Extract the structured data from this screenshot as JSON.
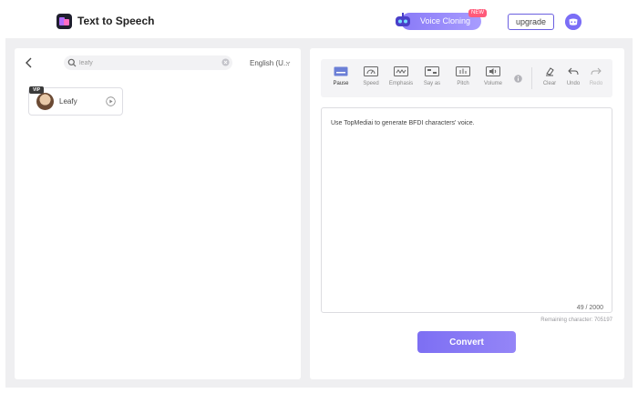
{
  "header": {
    "app_title": "Text to Speech",
    "voice_cloning_label": "Voice Cloning",
    "new_badge": "NEW",
    "upgrade_label": "upgrade"
  },
  "left": {
    "search": {
      "value": "leafy"
    },
    "language": "English (U...",
    "voice_card": {
      "badge": "VIP",
      "name": "Leafy"
    }
  },
  "toolbar": {
    "tools": [
      {
        "label": "Pause",
        "icon": "pause-icon"
      },
      {
        "label": "Speed",
        "icon": "speed-icon"
      },
      {
        "label": "Emphasis",
        "icon": "emphasis-icon"
      },
      {
        "label": "Say as",
        "icon": "say-as-icon"
      },
      {
        "label": "Pitch",
        "icon": "pitch-icon"
      },
      {
        "label": "Volume",
        "icon": "volume-icon"
      },
      {
        "label": "Clear",
        "icon": "eraser-icon"
      },
      {
        "label": "Undo",
        "icon": "undo-icon"
      },
      {
        "label": "Redo",
        "icon": "redo-icon"
      }
    ]
  },
  "editor": {
    "text": "Use TopMediai to generate BFDI characters' voice.",
    "char_count": "49 / 2000",
    "remaining": "Remaining character: 705197"
  },
  "convert_label": "Convert",
  "colors": {
    "accent": "#7d6ff3",
    "badge": "#ff5a7a"
  }
}
